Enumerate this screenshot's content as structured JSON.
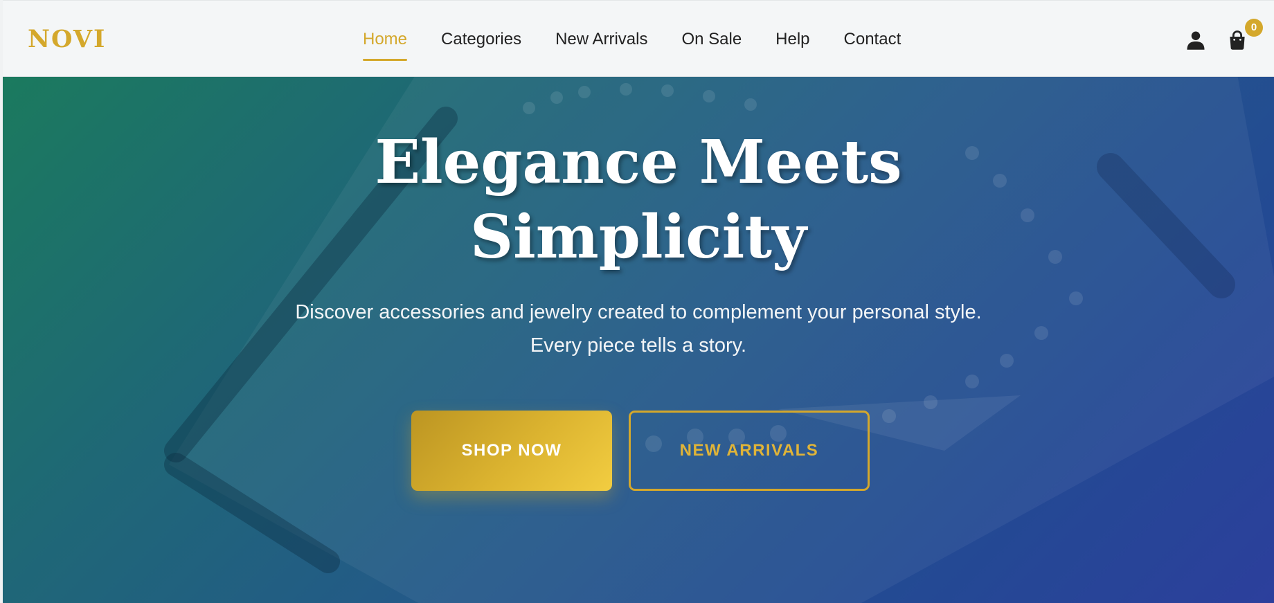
{
  "brand": {
    "logo_text": "NOVI",
    "accent_color": "#d4a82c"
  },
  "nav": {
    "items": [
      {
        "label": "Home",
        "active": true
      },
      {
        "label": "Categories",
        "active": false
      },
      {
        "label": "New Arrivals",
        "active": false
      },
      {
        "label": "On Sale",
        "active": false
      },
      {
        "label": "Help",
        "active": false
      },
      {
        "label": "Contact",
        "active": false
      }
    ]
  },
  "header_icons": {
    "account_icon": "user-icon",
    "cart_icon": "shopping-bag-icon",
    "cart_count": "0"
  },
  "hero": {
    "title_line1": "Elegance Meets",
    "title_line2": "Simplicity",
    "subtitle": "Discover accessories and jewelry created to complement your personal style. Every piece tells a story.",
    "primary_button": "SHOP NOW",
    "secondary_button": "NEW ARRIVALS",
    "gradient_colors": [
      "#1b7a5e",
      "#24588a",
      "#2c3f9c"
    ]
  }
}
